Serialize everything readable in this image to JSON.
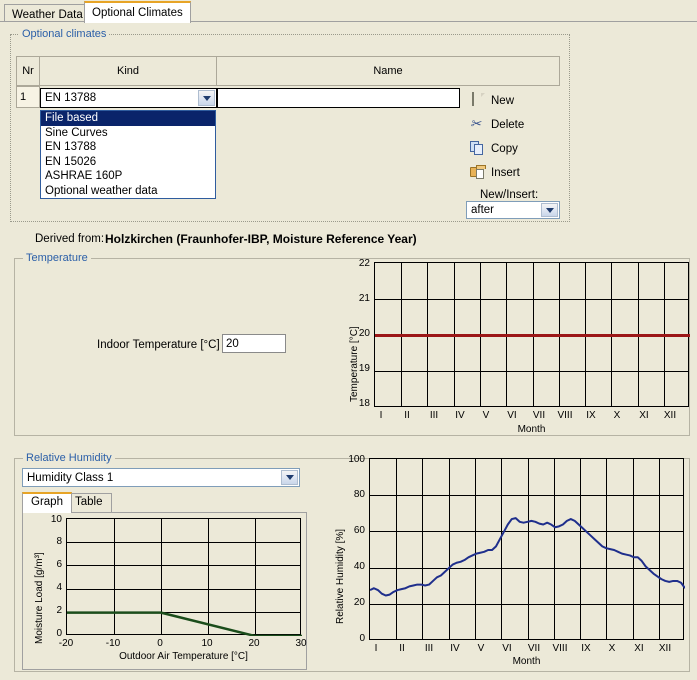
{
  "tabs": [
    {
      "label": "Weather Data",
      "active": false
    },
    {
      "label": "Optional Climates",
      "active": true
    }
  ],
  "optional_climates": {
    "legend": "Optional climates",
    "columns": [
      "Nr",
      "Kind",
      "Name"
    ],
    "row": {
      "nr": "1",
      "kind": "EN 13788",
      "name": ""
    },
    "kind_options": [
      "File based",
      "Sine Curves",
      "EN 13788",
      "EN 15026",
      "ASHRAE 160P",
      "Optional weather data"
    ],
    "kind_selected_option": "File based",
    "actions": [
      {
        "label": "New",
        "icon": "new-page-icon"
      },
      {
        "label": "Delete",
        "icon": "scissors-icon"
      },
      {
        "label": "Copy",
        "icon": "copy-icon"
      },
      {
        "label": "Insert",
        "icon": "folder-insert-icon"
      }
    ],
    "new_insert_label": "New/Insert:",
    "new_insert_value": "after"
  },
  "derived": {
    "label": "Derived from:",
    "value": "Holzkirchen (Fraunhofer-IBP, Moisture Reference Year)"
  },
  "temperature": {
    "legend": "Temperature",
    "indoor_label": "Indoor Temperature  [°C]",
    "indoor_value": "20"
  },
  "humidity": {
    "legend": "Relative Humidity",
    "class_value": "Humidity Class 1",
    "inner_tabs": [
      {
        "label": "Graph",
        "active": true
      },
      {
        "label": "Table",
        "active": false
      }
    ]
  },
  "chart_data": [
    {
      "type": "line",
      "id": "indoor-temperature-chart",
      "title": "",
      "xlabel": "Month",
      "ylabel": "Temperature [°C]",
      "ylim": [
        18,
        22
      ],
      "yticks": [
        18,
        19,
        20,
        21,
        22
      ],
      "categories": [
        "I",
        "II",
        "III",
        "IV",
        "V",
        "VI",
        "VII",
        "VIII",
        "IX",
        "X",
        "XI",
        "XII"
      ],
      "grid": true,
      "legend": "none",
      "color": "#9c1717",
      "series": [
        {
          "name": "Indoor Temperature",
          "values": [
            20,
            20,
            20,
            20,
            20,
            20,
            20,
            20,
            20,
            20,
            20,
            20
          ]
        }
      ]
    },
    {
      "type": "line",
      "id": "moisture-load-chart",
      "title": "",
      "xlabel": "Outdoor  Air  Temperature  [°C]",
      "ylabel": "Moisture Load [g/m³]",
      "xlim": [
        -20,
        30
      ],
      "ylim": [
        0,
        10
      ],
      "xticks": [
        -20,
        -10,
        0,
        10,
        20,
        30
      ],
      "yticks": [
        0,
        2,
        4,
        6,
        8,
        10
      ],
      "grid": true,
      "legend": "none",
      "color": "#1b4d1b",
      "series": [
        {
          "name": "Humidity Class 1",
          "x": [
            -20,
            0,
            20,
            30
          ],
          "values": [
            2,
            2,
            0,
            0
          ]
        }
      ]
    },
    {
      "type": "line",
      "id": "relative-humidity-chart",
      "title": "",
      "xlabel": "Month",
      "ylabel": "Relative Humidity [%]",
      "ylim": [
        0,
        100
      ],
      "yticks": [
        0,
        20,
        40,
        60,
        80,
        100
      ],
      "categories": [
        "I",
        "II",
        "III",
        "IV",
        "V",
        "VI",
        "VII",
        "VIII",
        "IX",
        "X",
        "XI",
        "XII"
      ],
      "grid": true,
      "legend": "none",
      "color": "#1f2f8c",
      "series": [
        {
          "name": "Relative Humidity",
          "x": [
            0,
            0.15,
            0.3,
            0.45,
            0.6,
            0.75,
            0.9,
            1.05,
            1.2,
            1.35,
            1.5,
            1.65,
            1.8,
            1.95,
            2.1,
            2.25,
            2.4,
            2.55,
            2.7,
            2.85,
            3.0,
            3.15,
            3.3,
            3.45,
            3.6,
            3.75,
            3.9,
            4.05,
            4.2,
            4.35,
            4.5,
            4.65,
            4.8,
            4.95,
            5.1,
            5.25,
            5.4,
            5.55,
            5.7,
            5.85,
            6.0,
            6.15,
            6.3,
            6.45,
            6.6,
            6.75,
            6.9,
            7.05,
            7.2,
            7.35,
            7.5,
            7.65,
            7.8,
            7.95,
            8.1,
            8.25,
            8.4,
            8.55,
            8.7,
            8.85,
            9.0,
            9.15,
            9.3,
            9.45,
            9.6,
            9.75,
            9.9,
            10.05,
            10.2,
            10.35,
            10.5,
            10.65,
            10.8,
            10.95,
            11.1,
            11.25,
            11.4,
            11.55,
            11.7,
            11.85,
            12.0
          ],
          "values": [
            28,
            29,
            28,
            26,
            25,
            25.5,
            27,
            28,
            28.5,
            29,
            30,
            30.5,
            31,
            31,
            30.5,
            31,
            33,
            35,
            36,
            38,
            40,
            42,
            43,
            43.5,
            44.5,
            46,
            47,
            48,
            48.5,
            49,
            50,
            50,
            52,
            56,
            60,
            64,
            67,
            67.5,
            65.5,
            65,
            65.5,
            66,
            65.5,
            64.5,
            64,
            65,
            64,
            62.5,
            63,
            64,
            66,
            67,
            66,
            64,
            62,
            60,
            58,
            56,
            54,
            52,
            51,
            50.5,
            50,
            49,
            48,
            47.5,
            47,
            46,
            46,
            44,
            41,
            39,
            37,
            35.5,
            34,
            33,
            32.5,
            33,
            33,
            32,
            29
          ]
        }
      ]
    }
  ]
}
